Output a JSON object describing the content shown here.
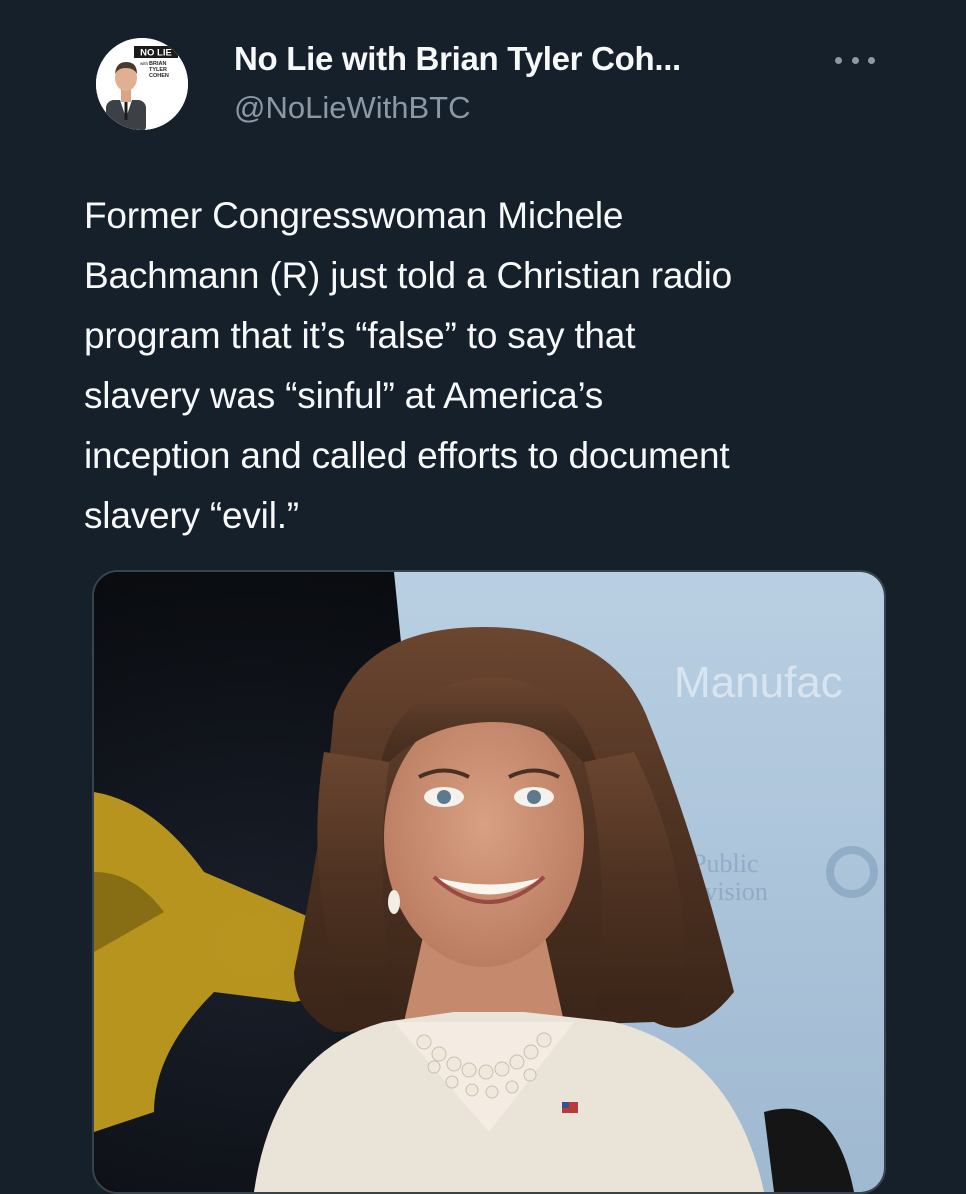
{
  "tweet": {
    "author": {
      "display_name": "No Lie with Brian Tyler Coh...",
      "handle": "@NoLieWithBTC",
      "avatar_badge": "NO LIE",
      "avatar_brand": [
        "with",
        "BRIAN",
        "TYLER",
        "COHEN"
      ]
    },
    "more_icon": "more-horizontal-icon",
    "text_lines": [
      "Former Congresswoman Michele",
      "Bachmann (R) just told a Christian radio",
      "program that it’s “false” to say that",
      "slavery was “sinful” at America’s",
      "inception and called efforts to document",
      "slavery “evil.”"
    ],
    "media": {
      "backdrop_text": "Manufac",
      "backdrop_logo_text": [
        "a Public",
        "elevision"
      ]
    }
  },
  "colors": {
    "background": "#15202b",
    "text_primary": "#f7f9f9",
    "text_secondary": "#8b98a5",
    "border": "#38444d"
  }
}
